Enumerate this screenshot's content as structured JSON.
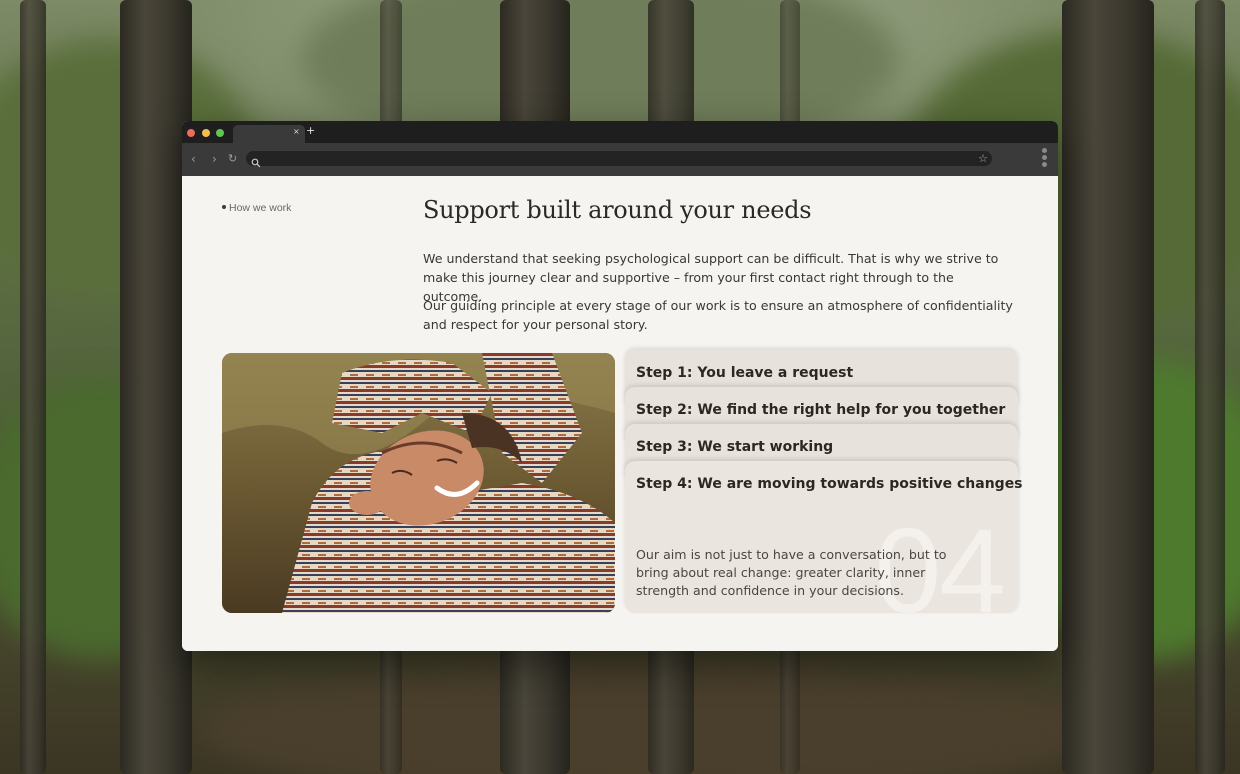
{
  "page": {
    "section_label": "How we work",
    "title": "Support built around your needs",
    "paragraphs": [
      "We understand that seeking psychological support can be difficult. That is why we strive to make this journey clear and supportive – from your first contact right through to the outcome.",
      "Our guiding principle at every stage of our work is to ensure an atmosphere of confidentiality and respect for your personal story."
    ]
  },
  "steps": [
    {
      "title": "Step 1: You leave a request"
    },
    {
      "title": "Step 2: We find the right help for you together"
    },
    {
      "title": "Step 3: We start working"
    },
    {
      "title": "Step 4: We are moving towards positive changes",
      "number": "04",
      "description": "Our aim is not just to have a conversation, but to bring about real change: greater clarity, inner strength and confidence in your decisions."
    }
  ],
  "browser": {
    "tab_close": "×",
    "new_tab": "+",
    "back": "‹",
    "forward": "›",
    "reload": "↻",
    "star": "☆"
  },
  "colors": {
    "page_background": "#f6f4f1",
    "step_card": "#e8e2dc",
    "browser_chrome": "#3a3a3a"
  },
  "icons": [
    "back-icon",
    "forward-icon",
    "reload-icon",
    "search-icon",
    "star-icon",
    "menu-icon",
    "close-icon",
    "plus-icon"
  ]
}
